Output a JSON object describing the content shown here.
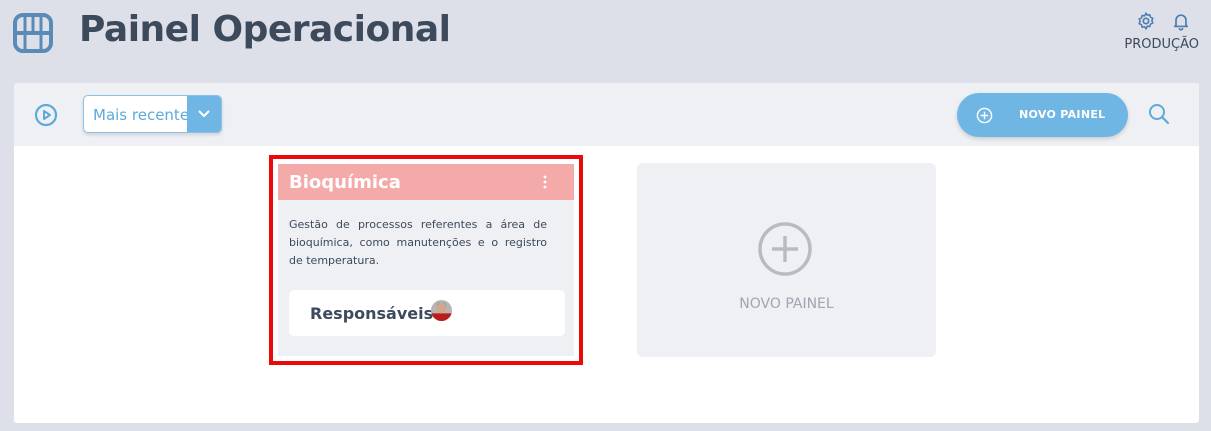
{
  "header": {
    "title": "Painel Operacional",
    "environment_label": "PRODUÇÃO",
    "logo_icon": "film-grid-icon",
    "settings_icon": "gear-icon",
    "notifications_icon": "bell-icon"
  },
  "toolbar": {
    "play_icon": "play-circle-icon",
    "sort": {
      "selected": "Mais recentes",
      "caret_icon": "chevron-down-icon"
    },
    "new_panel_button": {
      "label": "NOVO PAINEL",
      "icon": "plus-circle-icon"
    },
    "search_icon": "search-icon"
  },
  "boards": [
    {
      "title": "Bioquímica",
      "description": "Gestão de processos referentes a área de bioquímica, como manutenções e o registro de temperatura.",
      "responsibles_label": "Responsáveis",
      "header_color": "#f5aaaa",
      "highlighted": true
    }
  ],
  "new_board_card": {
    "label": "NOVO PAINEL",
    "icon": "plus-circle-icon"
  },
  "colors": {
    "accent": "#6fb6e5",
    "title_text": "#3c4a5c",
    "highlight_border": "#ea0a0a",
    "page_background": "#dde0e8"
  }
}
